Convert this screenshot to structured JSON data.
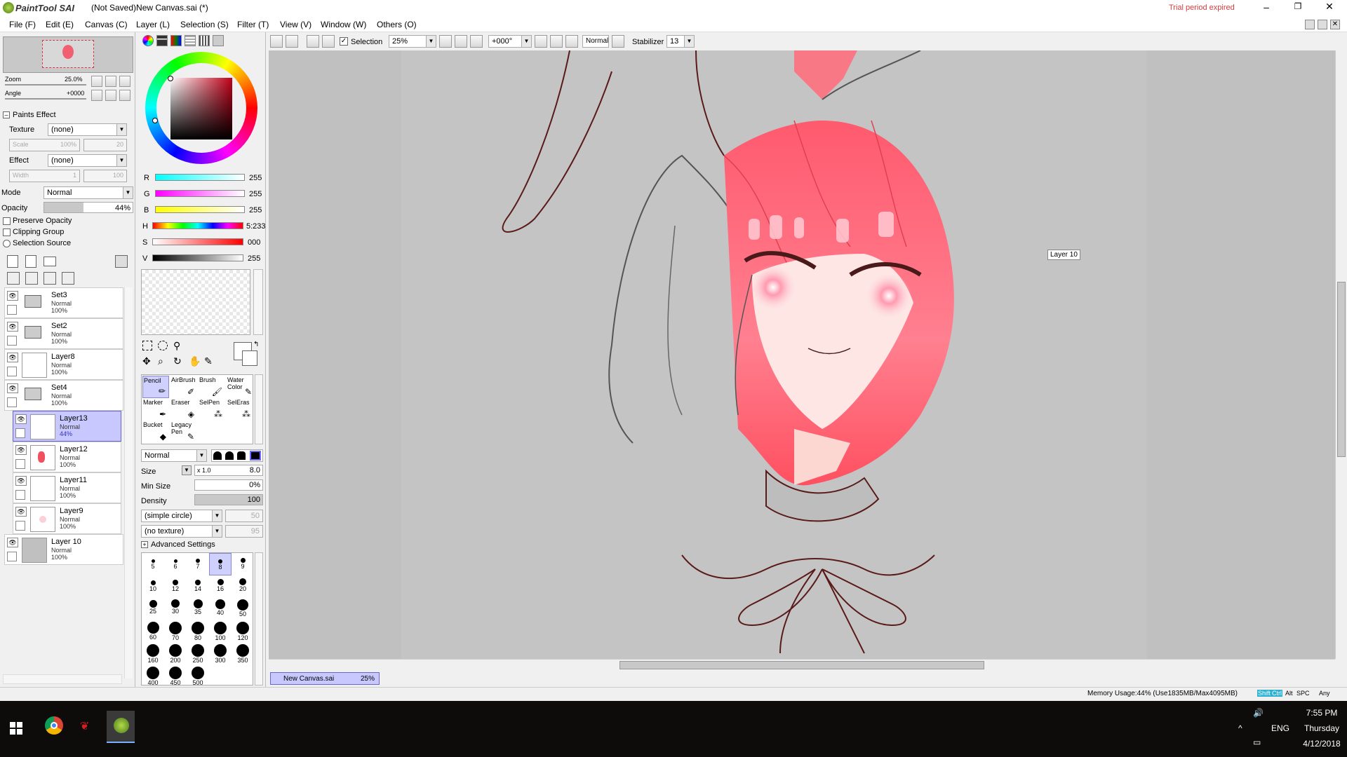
{
  "app": {
    "logo_text": "PaintTool SAI",
    "doc_title": "(Not Saved)New Canvas.sai (*)",
    "trial": "Trial period expired"
  },
  "menu": [
    "File (F)",
    "Edit (E)",
    "Canvas (C)",
    "Layer (L)",
    "Selection (S)",
    "Filter (T)",
    "View (V)",
    "Window (W)",
    "Others (O)"
  ],
  "toolbar": {
    "selection_label": "Selection",
    "zoom_value": "25%",
    "angle_value": "+000°",
    "mode_value": "Normal",
    "stabilizer_label": "Stabilizer",
    "stabilizer_value": "13"
  },
  "navigator": {
    "zoom_label": "Zoom",
    "zoom_value": "25.0%",
    "angle_label": "Angle",
    "angle_value": "+0000"
  },
  "paints_effect": {
    "header": "Paints Effect",
    "texture_label": "Texture",
    "texture_value": "(none)",
    "scale_label": "Scale",
    "scale_value": "100%",
    "scale_num": "20",
    "effect_label": "Effect",
    "effect_value": "(none)",
    "width_label": "Width",
    "width_value": "1",
    "width_num": "100"
  },
  "layer_props": {
    "mode_label": "Mode",
    "mode_value": "Normal",
    "opacity_label": "Opacity",
    "opacity_value": "44%",
    "preserve_opacity": "Preserve Opacity",
    "clipping_group": "Clipping Group",
    "selection_source": "Selection Source"
  },
  "layers": [
    {
      "name": "Set3",
      "mode": "Normal",
      "opacity": "100%",
      "type": "folder",
      "indent": 0,
      "selected": false
    },
    {
      "name": "Set2",
      "mode": "Normal",
      "opacity": "100%",
      "type": "folder",
      "indent": 0,
      "selected": false
    },
    {
      "name": "Layer8",
      "mode": "Normal",
      "opacity": "100%",
      "type": "layer",
      "indent": 0,
      "selected": false
    },
    {
      "name": "Set4",
      "mode": "Normal",
      "opacity": "100%",
      "type": "folder",
      "indent": 0,
      "selected": false
    },
    {
      "name": "Layer13",
      "mode": "Normal",
      "opacity": "44%",
      "type": "layer",
      "indent": 1,
      "selected": true
    },
    {
      "name": "Layer12",
      "mode": "Normal",
      "opacity": "100%",
      "type": "layer",
      "indent": 1,
      "selected": false
    },
    {
      "name": "Layer11",
      "mode": "Normal",
      "opacity": "100%",
      "type": "layer",
      "indent": 1,
      "selected": false
    },
    {
      "name": "Layer9",
      "mode": "Normal",
      "opacity": "100%",
      "type": "layer",
      "indent": 1,
      "selected": false
    },
    {
      "name": "Layer 10",
      "mode": "Normal",
      "opacity": "100%",
      "type": "layer",
      "indent": 0,
      "selected": false
    }
  ],
  "color": {
    "r_label": "R",
    "r_value": "255",
    "g_label": "G",
    "g_value": "255",
    "b_label": "B",
    "b_value": "255",
    "h_label": "H",
    "h_value": "5:233",
    "s_label": "S",
    "s_value": "000",
    "v_label": "V",
    "v_value": "255",
    "accent": "#8b0000"
  },
  "tools": [
    {
      "label": "Pencil",
      "selected": true
    },
    {
      "label": "AirBrush",
      "selected": false
    },
    {
      "label": "Brush",
      "selected": false
    },
    {
      "label": "Water Color",
      "selected": false
    },
    {
      "label": "Marker",
      "selected": false
    },
    {
      "label": "Eraser",
      "selected": false
    },
    {
      "label": "SelPen",
      "selected": false
    },
    {
      "label": "SelEras",
      "selected": false
    },
    {
      "label": "Bucket",
      "selected": false
    },
    {
      "label": "Legacy Pen",
      "selected": false
    }
  ],
  "brush": {
    "blend_mode": "Normal",
    "size_label": "Size",
    "size_mult": "x 1.0",
    "size_value": "8.0",
    "min_size_label": "Min Size",
    "min_size_value": "0%",
    "density_label": "Density",
    "density_value": "100",
    "shape": "(simple circle)",
    "shape_num": "50",
    "texture": "(no texture)",
    "texture_num": "95",
    "advanced": "Advanced Settings"
  },
  "brush_sizes": [
    "5",
    "6",
    "7",
    "8",
    "9",
    "10",
    "12",
    "14",
    "16",
    "20",
    "25",
    "30",
    "35",
    "40",
    "50",
    "60",
    "70",
    "80",
    "100",
    "120",
    "160",
    "200",
    "250",
    "300",
    "350",
    "400",
    "450",
    "500"
  ],
  "canvas": {
    "layer_tooltip": "Layer 10",
    "tab_name": "New Canvas.sai",
    "tab_zoom": "25%"
  },
  "status": {
    "memory": "Memory Usage:44% (Use1835MB/Max4095MB)",
    "keys": [
      "Shift",
      "Ctrl",
      "Alt",
      "SPC",
      "Any"
    ]
  },
  "taskbar": {
    "time": "7:55 PM",
    "day": "Thursday",
    "date": "4/12/2018",
    "lang": "ENG"
  }
}
